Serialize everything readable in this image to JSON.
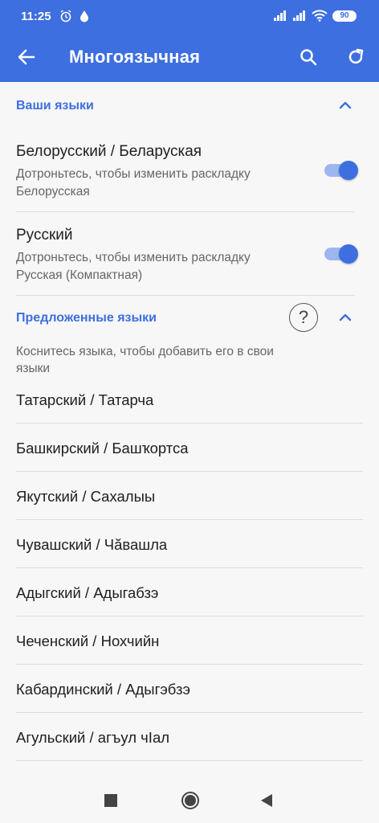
{
  "status": {
    "time": "11:25",
    "battery": "90"
  },
  "appbar": {
    "title": "Многоязычная"
  },
  "your_languages": {
    "header": "Ваши языки",
    "items": [
      {
        "name": "Белорусский / Беларуская",
        "hint": "Дотроньтесь, чтобы изменить раскладку",
        "layout": "Белорусская",
        "enabled": true
      },
      {
        "name": "Русский",
        "hint": "Дотроньтесь, чтобы изменить раскладку",
        "layout": "Русская (Компактная)",
        "enabled": true
      }
    ]
  },
  "suggested": {
    "header": "Предложенные языки",
    "help": "?",
    "hint": "Коснитесь языка, чтобы добавить его в свои языки",
    "items": [
      "Татарский / Татарча",
      "Башкирский / Башҡортса",
      "Якутский / Сахалыы",
      "Чувашский / Чӑвашла",
      "Адыгский / Адыгабзэ",
      "Чеченский / Нохчийн",
      "Кабардинский / Адыгэбзэ",
      "Агульский / агъул чӀал"
    ]
  },
  "colors": {
    "accent": "#3d6fe0"
  }
}
